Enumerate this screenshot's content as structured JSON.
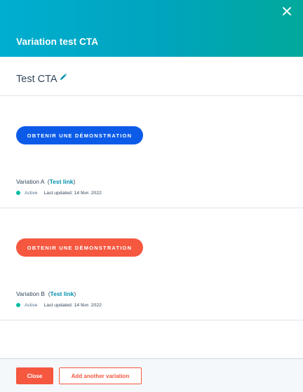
{
  "header": {
    "title": "Variation test CTA",
    "close_icon": "close-icon"
  },
  "cta_name": {
    "value": "Test CTA",
    "edit_icon": "pencil-icon"
  },
  "variations": [
    {
      "cta_label": "Obtenir une démonstration",
      "cta_color": "#0b5be8",
      "name": "Variation A",
      "link_label": "Test link",
      "status": "Active",
      "status_color": "#00bda5",
      "last_updated": "Last updated: 14 févr. 2022"
    },
    {
      "cta_label": "Obtenir une démonstration",
      "cta_color": "#f5573f",
      "name": "Variation B",
      "link_label": "Test link",
      "status": "Active",
      "status_color": "#00bda5",
      "last_updated": "Last updated: 14 févr. 2022"
    }
  ],
  "footer": {
    "close_label": "Close",
    "add_label": "Add another variation"
  },
  "colors": {
    "header_gradient_start": "#00aed0",
    "header_gradient_end": "#00a99b",
    "accent_orange": "#f5573f",
    "link": "#0091ae"
  }
}
